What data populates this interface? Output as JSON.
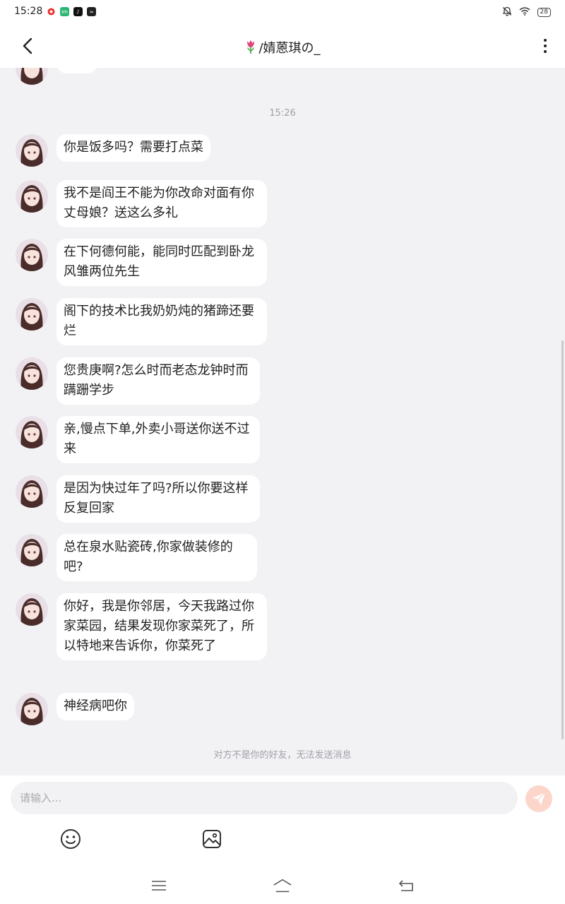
{
  "status_bar": {
    "time": "15:28",
    "battery": "28",
    "app_icons": [
      "red-app-icon",
      "green-app-icon",
      "tiktok-icon",
      "dark-app-icon"
    ]
  },
  "header": {
    "title": "/婧蒽琪の_",
    "title_emoji": "tulip-icon"
  },
  "chat": {
    "timestamp": "15:26",
    "messages": [
      {
        "text": "你是饭多吗？需要打点菜"
      },
      {
        "text": "我不是阎王不能为你改命对面有你丈母娘？送这么多礼"
      },
      {
        "text": "在下何德何能，能同时匹配到卧龙风雏两位先生"
      },
      {
        "text": "阁下的技术比我奶奶炖的猪蹄还要烂"
      },
      {
        "text": "您贵庚啊?怎么时而老态龙钟时而蹒跚学步"
      },
      {
        "text": "亲,慢点下单,外卖小哥送你送不过来"
      },
      {
        "text": "是因为快过年了吗?所以你要这样反复回家"
      },
      {
        "text": "总在泉水贴瓷砖,你家做装修的吧?"
      },
      {
        "text": "你好，我是你邻居，今天我路过你家菜园，结果发现你家菜死了，所以特地来告诉你，你菜死了"
      },
      {
        "text": "神经病吧你"
      }
    ],
    "notice": "对方不是你的好友，无法发送消息"
  },
  "composer": {
    "placeholder": "请输入..."
  },
  "colors": {
    "background": "#f2f2f5",
    "bubble": "#ffffff",
    "send_button": "#fcd6cb",
    "send_icon": "#ffffff",
    "muted_text": "#a0a0a8"
  }
}
